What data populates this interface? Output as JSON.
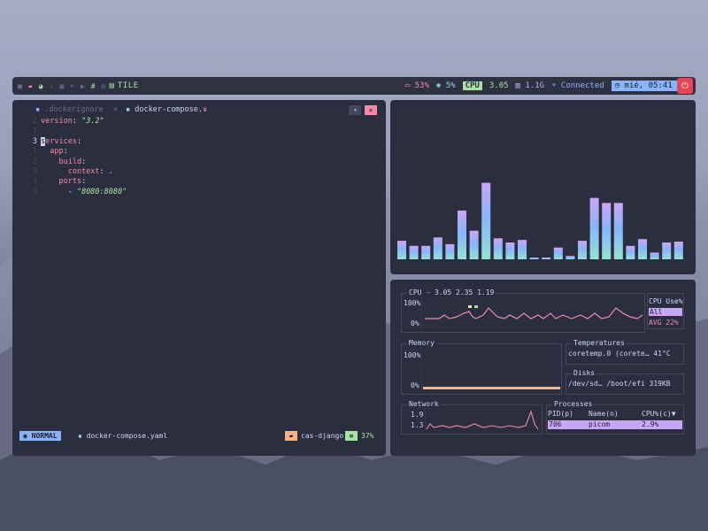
{
  "colors": {
    "accent": "#89b4fa",
    "red": "#f38ba8",
    "green": "#a6e3a1",
    "mauve": "#cba6f7",
    "panel": "#2b2e3f"
  },
  "topbar": {
    "workspace_icons": [
      "terminal-icon",
      "folder-icon",
      "steam-icon",
      "download-icon",
      "image-icon",
      "telegram-icon",
      "youtube-icon",
      "slack-icon",
      "settings-icon"
    ],
    "layout_label": "TILE",
    "battery": "53%",
    "brightness": "5%",
    "cpu_label": "CPU",
    "cpu_value": "3.05",
    "memory": "1.1G",
    "network": "Connected",
    "clock": "mié, 05:41 PM"
  },
  "editor": {
    "tabs": [
      {
        "name": ".dockerignore",
        "close": "×"
      },
      {
        "name": "docker-compose..",
        "close": "×"
      }
    ],
    "code": [
      {
        "num": "2",
        "text": "version: \"3.2\""
      },
      {
        "num": "1",
        "text": ""
      },
      {
        "num": "3",
        "text": "services:"
      },
      {
        "num": "1",
        "text": "  app:"
      },
      {
        "num": "2",
        "text": "    build:"
      },
      {
        "num": "3",
        "text": "      context: ."
      },
      {
        "num": "4",
        "text": "    ports:"
      },
      {
        "num": "5",
        "text": "      - \"8080:8080\""
      }
    ],
    "status": {
      "mode": "NORMAL",
      "file": "docker-compose.yaml",
      "project": "cas-django",
      "percent": "37%"
    }
  },
  "visualizer": {
    "bar_levels": [
      0.22,
      0.16,
      0.16,
      0.26,
      0.18,
      0.58,
      0.34,
      0.91,
      0.25,
      0.2,
      0.23,
      0.01,
      0.01,
      0.14,
      0.04,
      0.22,
      0.73,
      0.67,
      0.67,
      0.16,
      0.24,
      0.08,
      0.2,
      0.21
    ]
  },
  "btop": {
    "cpu_title": "CPU",
    "cpu_load": "3.05 2.35 1.19",
    "cpu_hi": "100%",
    "cpu_lo": "0%",
    "cpu_use_title": "CPU Use%",
    "cpu_use_sel": "All",
    "cpu_use_avg": "AVG 22%",
    "mem_title": "Memory",
    "mem_hi": "100%",
    "mem_lo": "0%",
    "temp_title": "Temperatures",
    "temp_row": "coretemp.0 (corete… 41°C",
    "disks_title": "Disks",
    "disks_row": "/dev/sd… /boot/efi 319KB",
    "net_title": "Network",
    "net_hi": "1.9",
    "net_lo": "1.3",
    "proc_title": "Processes",
    "proc_cols": [
      "PID(p)",
      "Name(n)",
      "CPU%(c)▼"
    ],
    "proc_row": [
      "706",
      "picom",
      "2.9%"
    ]
  }
}
